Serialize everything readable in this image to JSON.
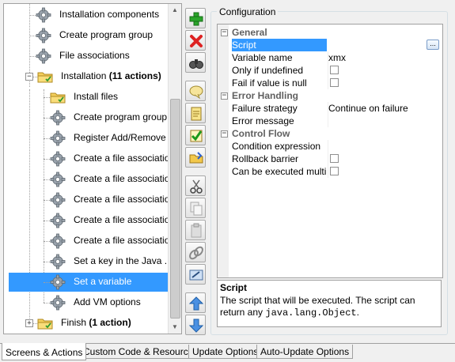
{
  "tree": {
    "items": [
      {
        "label": "Installation components",
        "icon": "gear-icon"
      },
      {
        "label": "Create program group",
        "icon": "gear-icon"
      },
      {
        "label": "File associations",
        "icon": "gear-icon"
      },
      {
        "label": "Installation",
        "count_label": "(11 actions)",
        "icon": "folder-icon",
        "expander": "−"
      },
      {
        "label": "Install files",
        "icon": "folder-icon"
      },
      {
        "label": "Create program group",
        "icon": "gear-icon"
      },
      {
        "label": "Register Add/Remove ...",
        "icon": "gear-icon"
      },
      {
        "label": "Create a file association",
        "icon": "gear-icon"
      },
      {
        "label": "Create a file association",
        "icon": "gear-icon"
      },
      {
        "label": "Create a file association",
        "icon": "gear-icon"
      },
      {
        "label": "Create a file association",
        "icon": "gear-icon"
      },
      {
        "label": "Create a file association",
        "icon": "gear-icon"
      },
      {
        "label": "Set a key in the Java ...",
        "icon": "gear-icon"
      },
      {
        "label": "Set a variable",
        "icon": "gear-icon",
        "selected": true
      },
      {
        "label": "Add VM options",
        "icon": "gear-icon"
      },
      {
        "label": "Finish",
        "count_label": "(1 action)",
        "icon": "folder-icon",
        "expander": "+"
      }
    ],
    "scroll_up": "▲",
    "scroll_down": "▼"
  },
  "toolbar": {
    "buttons": [
      "add-icon",
      "delete-icon",
      "find-icon",
      "comment-icon",
      "note-icon",
      "check-icon",
      "folder-open-icon",
      "cut-icon",
      "copy-icon",
      "paste-icon",
      "link-icon",
      "edit-icon",
      "move-up-icon",
      "move-down-icon"
    ]
  },
  "config": {
    "title": "Configuration",
    "categories": {
      "general": "General",
      "error_handling": "Error Handling",
      "control_flow": "Control Flow"
    },
    "props": {
      "script": {
        "name": "Script",
        "value": "",
        "button": "..."
      },
      "variable_name": {
        "name": "Variable name",
        "value": "xmx"
      },
      "only_if_undefined": {
        "name": "Only if undefined",
        "checked": false
      },
      "fail_if_null": {
        "name": "Fail if value is null",
        "checked": false
      },
      "failure_strategy": {
        "name": "Failure strategy",
        "value": "Continue on failure"
      },
      "error_message": {
        "name": "Error message",
        "value": ""
      },
      "condition_expression": {
        "name": "Condition expression",
        "value": ""
      },
      "rollback_barrier": {
        "name": "Rollback barrier",
        "checked": false
      },
      "can_be_executed": {
        "name": "Can be executed multi...",
        "checked": false
      }
    },
    "description": {
      "title": "Script",
      "text_pre": "The script that will be executed. The script can return any ",
      "code": "java.lang.Object",
      "text_post": "."
    }
  },
  "tabs": [
    {
      "label": "Screens & Actions",
      "active": true
    },
    {
      "label": "Custom Code & Resources",
      "active": false
    },
    {
      "label": "Update Options",
      "active": false
    },
    {
      "label": "Auto-Update Options",
      "active": false
    }
  ]
}
